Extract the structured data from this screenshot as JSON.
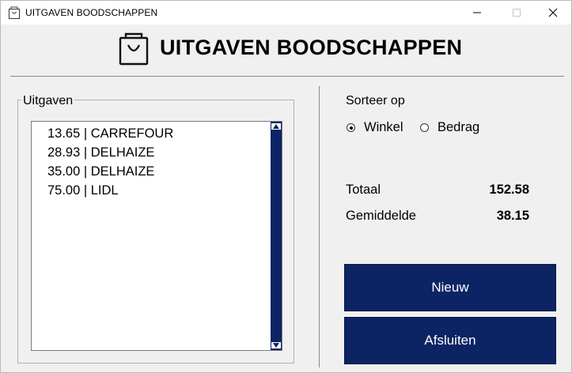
{
  "window": {
    "title": "UITGAVEN BOODSCHAPPEN",
    "controls": [
      "minimize",
      "maximize",
      "close"
    ]
  },
  "header": {
    "title": "UITGAVEN BOODSCHAPPEN",
    "icon": "shopping-bag-icon"
  },
  "expenses": {
    "group_label": "Uitgaven",
    "items": [
      "13.65 | CARREFOUR",
      "28.93 | DELHAIZE",
      "35.00 | DELHAIZE",
      "75.00 | LIDL"
    ]
  },
  "sort": {
    "label": "Sorteer op",
    "options": [
      {
        "label": "Winkel",
        "checked": true
      },
      {
        "label": "Bedrag",
        "checked": false
      }
    ]
  },
  "stats": {
    "total_label": "Totaal",
    "total_value": "152.58",
    "average_label": "Gemiddelde",
    "average_value": "38.15"
  },
  "buttons": {
    "new_label": "Nieuw",
    "close_label": "Afsluiten"
  },
  "colors": {
    "accent": "#0c2464",
    "background": "#f0f0f0"
  }
}
